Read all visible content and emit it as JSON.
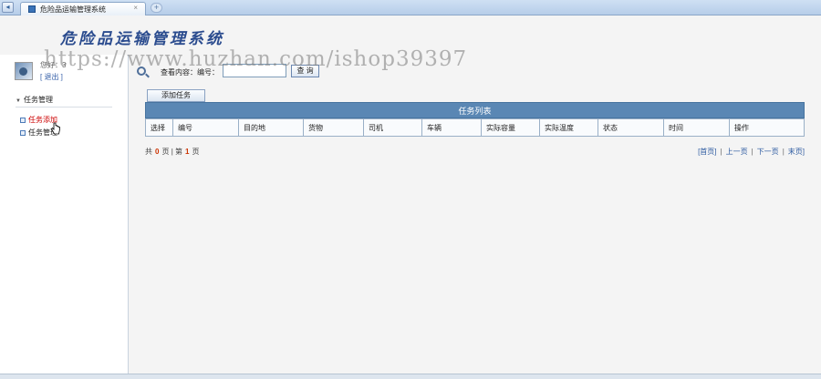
{
  "browser": {
    "tab_title": "危险品运输管理系统",
    "tab_close": "×",
    "new_tab": "+",
    "back": "◂"
  },
  "header": {
    "system_title": "危险品运输管理系统",
    "watermark": "https://www.huzhan.com/ishop39397"
  },
  "sidebar": {
    "greeting": "您好：3",
    "logout": "[ 退出 ]",
    "group_arrow": "▼",
    "group_label": "任务管理",
    "items": [
      {
        "label": "任务添加",
        "active": true
      },
      {
        "label": "任务管理",
        "active": false
      }
    ]
  },
  "search": {
    "label": "查看内容：编号：",
    "input_value": "",
    "button_label": "查 询"
  },
  "toolbar": {
    "add_task_label": "添加任务"
  },
  "task_table": {
    "title": "任务列表",
    "columns": [
      "选择",
      "编号",
      "目的地",
      "货物",
      "司机",
      "车辆",
      "实际容量",
      "实际温度",
      "状态",
      "时间",
      "操作"
    ],
    "rows": []
  },
  "pager": {
    "total_prefix": "共",
    "total_count": "0",
    "total_suffix": "页",
    "divider": "|",
    "current_prefix": "第",
    "current_page": "1",
    "current_suffix": "页",
    "first": "[首页]",
    "prev": "上一页",
    "next": "下一页",
    "last": "末页]",
    "sep": "|"
  },
  "colors": {
    "table_title_bg": "#5a87b4",
    "active_menu": "#cc0000",
    "link": "#2c5aa0"
  }
}
